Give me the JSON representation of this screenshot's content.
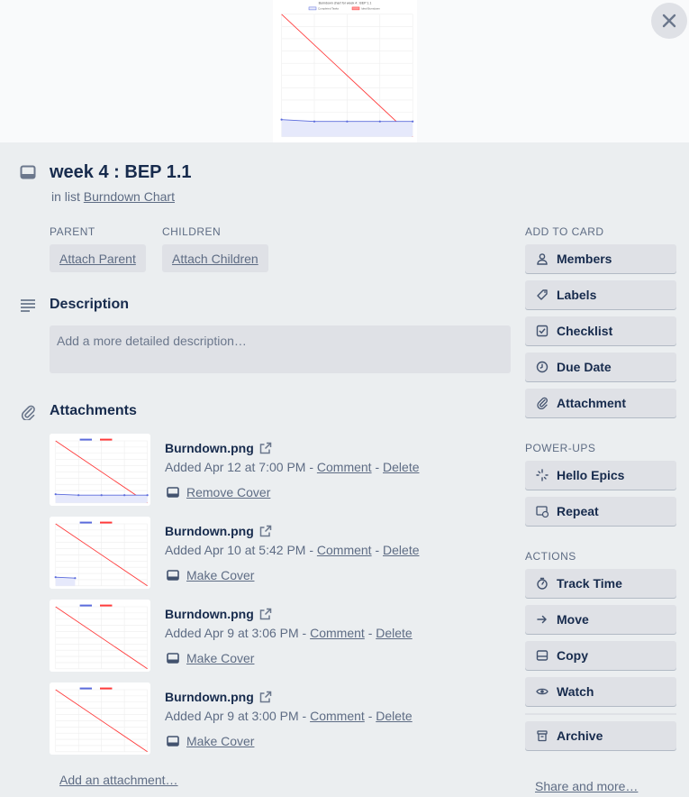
{
  "cover": {
    "chart_title": "Burndown chart for week 4 : BEP 1.1",
    "legend": [
      "Completed Tasks",
      "Ideal Burndown"
    ]
  },
  "card": {
    "title": "week 4 : BEP 1.1",
    "in_list_prefix": "in list",
    "list_name": "Burndown Chart"
  },
  "relations": {
    "parent_label": "PARENT",
    "children_label": "CHILDREN",
    "attach_parent": "Attach Parent",
    "attach_children": "Attach Children"
  },
  "description": {
    "title": "Description",
    "placeholder": "Add a more detailed description…"
  },
  "attachments": {
    "title": "Attachments",
    "add_label": "Add an attachment…",
    "items": [
      {
        "name": "Burndown.png",
        "added": "Added Apr 12 at 7:00 PM -",
        "comment": "Comment",
        "sep": "-",
        "delete": "Delete",
        "cover_action": "Remove Cover",
        "done_days": 4
      },
      {
        "name": "Burndown.png",
        "added": "Added Apr 10 at 5:42 PM -",
        "comment": "Comment",
        "sep": "-",
        "delete": "Delete",
        "cover_action": "Make Cover",
        "done_days": 1
      },
      {
        "name": "Burndown.png",
        "added": "Added Apr 9 at 3:06 PM -",
        "comment": "Comment",
        "sep": "-",
        "delete": "Delete",
        "cover_action": "Make Cover",
        "done_days": 0
      },
      {
        "name": "Burndown.png",
        "added": "Added Apr 9 at 3:00 PM -",
        "comment": "Comment",
        "sep": "-",
        "delete": "Delete",
        "cover_action": "Make Cover",
        "done_days": 0
      }
    ]
  },
  "sidebar": {
    "add_to_card_label": "ADD TO CARD",
    "add_to_card": [
      {
        "label": "Members",
        "icon": "person-icon"
      },
      {
        "label": "Labels",
        "icon": "tag-icon"
      },
      {
        "label": "Checklist",
        "icon": "checkbox-icon"
      },
      {
        "label": "Due Date",
        "icon": "clock-icon"
      },
      {
        "label": "Attachment",
        "icon": "paperclip-icon"
      }
    ],
    "power_ups_label": "POWER-UPS",
    "power_ups": [
      {
        "label": "Hello Epics",
        "icon": "sparkle-icon"
      },
      {
        "label": "Repeat",
        "icon": "repeat-card-icon"
      }
    ],
    "actions_label": "ACTIONS",
    "actions": [
      {
        "label": "Track Time",
        "icon": "stopwatch-icon"
      },
      {
        "label": "Move",
        "icon": "arrow-right-icon"
      },
      {
        "label": "Copy",
        "icon": "card-icon"
      },
      {
        "label": "Watch",
        "icon": "eye-icon"
      }
    ],
    "archive": {
      "label": "Archive",
      "icon": "archive-icon"
    },
    "share_label": "Share and more…"
  },
  "colors": {
    "ideal_line": "#ff3b3b",
    "completed_line": "#5b6bdc",
    "completed_fill": "#e6e9fb"
  }
}
